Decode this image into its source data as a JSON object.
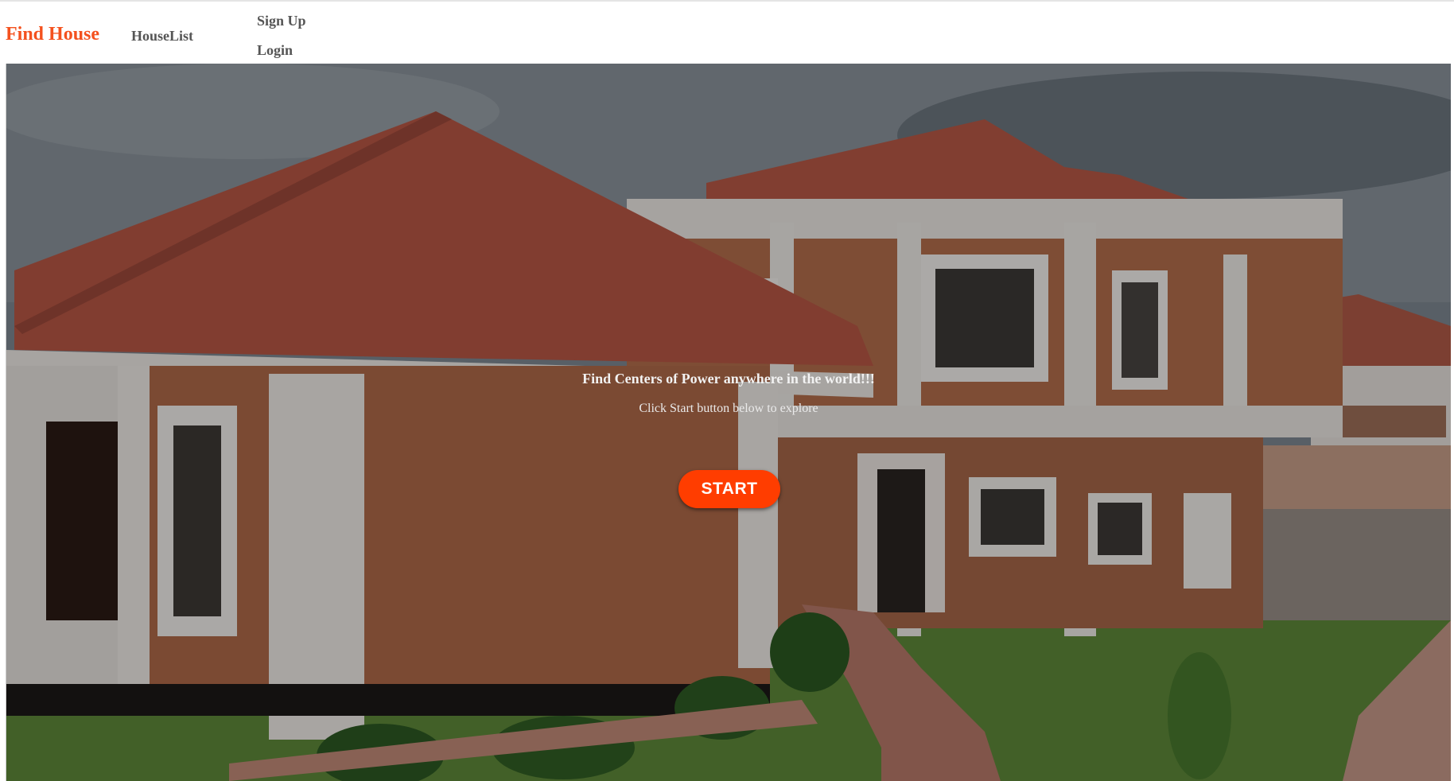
{
  "navbar": {
    "brand": "Find House",
    "links": {
      "houselist": "HouseList",
      "signup": "Sign Up",
      "login": "Login"
    }
  },
  "hero": {
    "heading": "Find Centers of Power anywhere in the world!!!",
    "subheading": "Click Start button below to explore",
    "start_label": "START",
    "background_image": "house-photo"
  },
  "colors": {
    "brand": "#f4511e",
    "start_button": "#ff3d00",
    "nav_text": "#555555"
  }
}
